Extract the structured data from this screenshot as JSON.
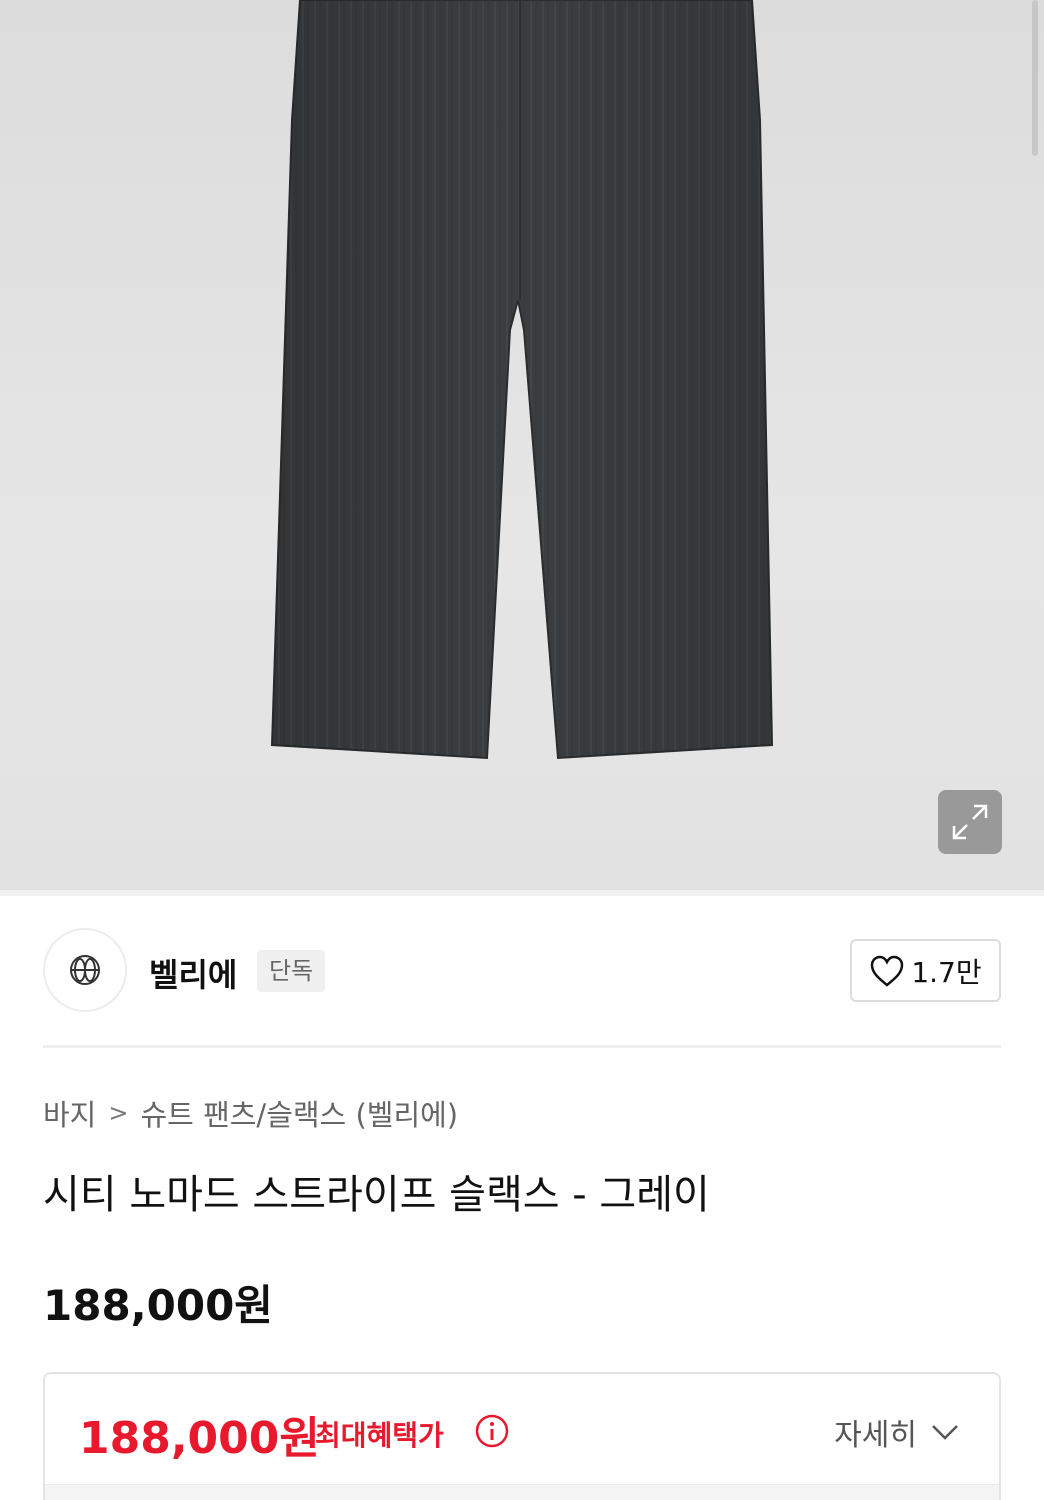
{
  "brand": {
    "name": "벨리에",
    "badge": "단독",
    "likes": "1.7만"
  },
  "breadcrumb": {
    "items": [
      "바지",
      "슈트 팬츠/슬랙스 (벨리에)"
    ]
  },
  "product": {
    "title": "시티 노마드 스트라이프 슬랙스 - 그레이",
    "price": "188,000원"
  },
  "benefit": {
    "price": "188,000원",
    "label": "최대혜택가",
    "detail": "자세히"
  },
  "colors": {
    "accent_red": "#e8192c",
    "pants": "#3a3d3f"
  },
  "icons": {
    "expand": "expand-icon",
    "heart": "heart-icon",
    "info": "info-icon",
    "chevron": "chevron-down-icon",
    "breadcrumb_sep": "chevron-right-icon"
  }
}
